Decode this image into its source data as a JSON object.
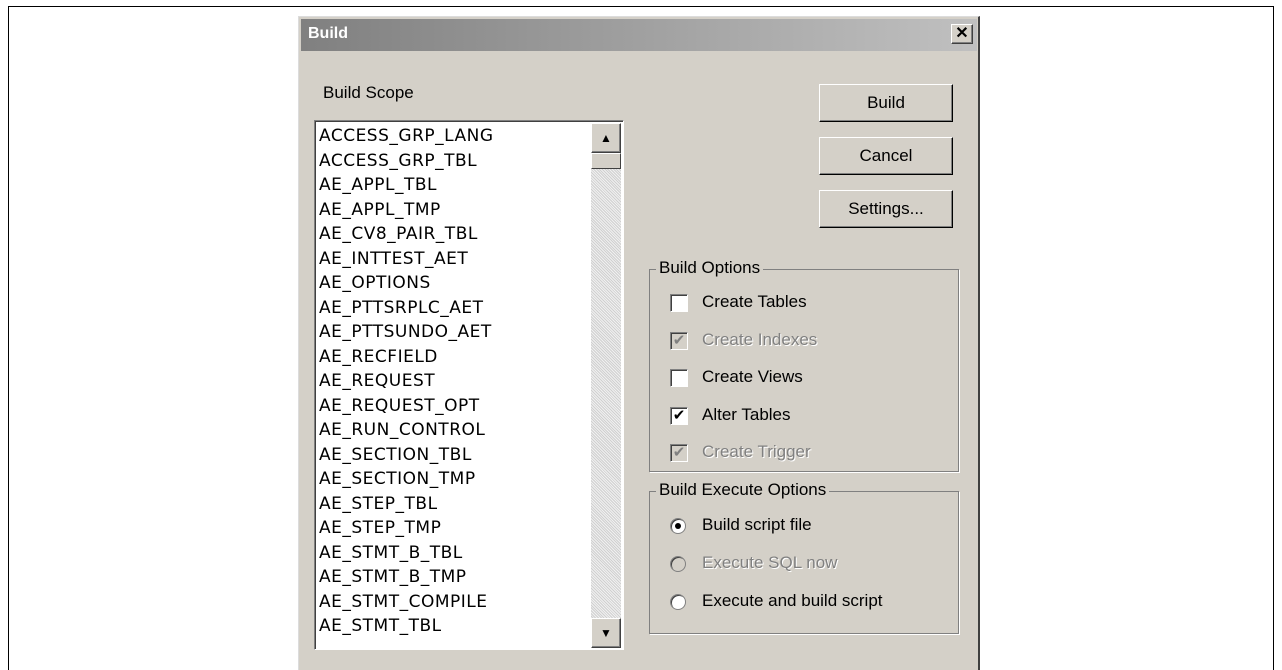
{
  "window": {
    "title": "Build",
    "close_label": "✕"
  },
  "scope": {
    "label": "Build Scope",
    "items": [
      "ACCESS_GRP_LANG",
      "ACCESS_GRP_TBL",
      "AE_APPL_TBL",
      "AE_APPL_TMP",
      "AE_CV8_PAIR_TBL",
      "AE_INTTEST_AET",
      "AE_OPTIONS",
      "AE_PTTSRPLC_AET",
      "AE_PTTSUNDO_AET",
      "AE_RECFIELD",
      "AE_REQUEST",
      "AE_REQUEST_OPT",
      "AE_RUN_CONTROL",
      "AE_SECTION_TBL",
      "AE_SECTION_TMP",
      "AE_STEP_TBL",
      "AE_STEP_TMP",
      "AE_STMT_B_TBL",
      "AE_STMT_B_TMP",
      "AE_STMT_COMPILE",
      "AE_STMT_TBL"
    ]
  },
  "buttons": {
    "build": "Build",
    "cancel": "Cancel",
    "settings": "Settings..."
  },
  "build_options": {
    "legend": "Build Options",
    "items": [
      {
        "label": "Create Tables",
        "checked": false,
        "enabled": true
      },
      {
        "label": "Create Indexes",
        "checked": true,
        "enabled": false
      },
      {
        "label": "Create Views",
        "checked": false,
        "enabled": true
      },
      {
        "label": "Alter Tables",
        "checked": true,
        "enabled": true
      },
      {
        "label": "Create Trigger",
        "checked": true,
        "enabled": false
      }
    ]
  },
  "execute_options": {
    "legend": "Build Execute Options",
    "items": [
      {
        "label": "Build script file",
        "selected": true,
        "enabled": true
      },
      {
        "label": "Execute SQL now",
        "selected": false,
        "enabled": false
      },
      {
        "label": "Execute and build script",
        "selected": false,
        "enabled": true
      }
    ]
  },
  "icons": {
    "scroll_up": "▲",
    "scroll_down": "▼",
    "check": "✔"
  }
}
